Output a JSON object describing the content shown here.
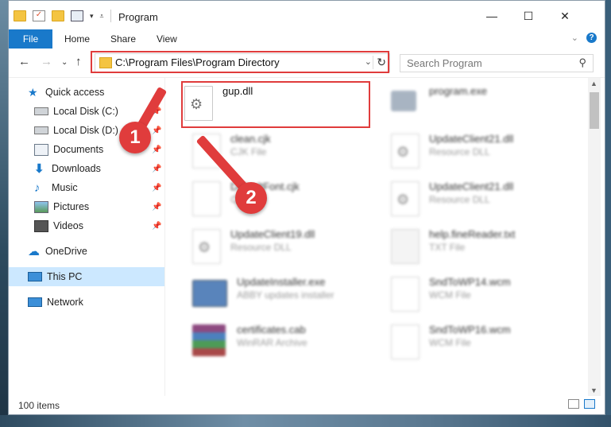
{
  "window": {
    "title": "Program"
  },
  "ribbon": {
    "file": "File",
    "home": "Home",
    "share": "Share",
    "view": "View"
  },
  "address": {
    "path": "C:\\Program Files\\Program Directory"
  },
  "search": {
    "placeholder": "Search Program"
  },
  "sidebar": {
    "quick_access": "Quick access",
    "items": [
      "Local Disk (C:)",
      "Local Disk (D:)",
      "Documents",
      "Downloads",
      "Music",
      "Pictures",
      "Videos"
    ],
    "onedrive": "OneDrive",
    "this_pc": "This PC",
    "network": "Network"
  },
  "files": {
    "gup": {
      "name": "gup.dll"
    },
    "program": {
      "name": "program.exe"
    },
    "clean": {
      "name": "clean.cjk",
      "type": "CJK File"
    },
    "default_font": {
      "name": "DefaultFont.cjk",
      "type": "CJK File"
    },
    "update19": {
      "name": "UpdateClient19.dll",
      "type": "Resource DLL"
    },
    "update21a": {
      "name": "UpdateClient21.dll",
      "type": "Resource DLL"
    },
    "update21b": {
      "name": "UpdateClient21.dll",
      "type": "Resource DLL"
    },
    "help": {
      "name": "help.fineReader.txt",
      "type": "TXT File"
    },
    "installer": {
      "name": "UpdateInstaller.exe",
      "type": "ABBY updates installer"
    },
    "sndwp14": {
      "name": "SndToWP14.wcm",
      "type": "WCM File"
    },
    "certificates": {
      "name": "certificates.cab",
      "type": "WinRAR Archive"
    },
    "sndwp16": {
      "name": "SndToWP16.wcm",
      "type": "WCM File"
    }
  },
  "status": {
    "count": "100 items"
  },
  "annotations": {
    "step1": "1",
    "step2": "2"
  },
  "colors": {
    "accent": "#1979ca",
    "highlight": "#e03c3c",
    "selection": "#cce8ff"
  }
}
